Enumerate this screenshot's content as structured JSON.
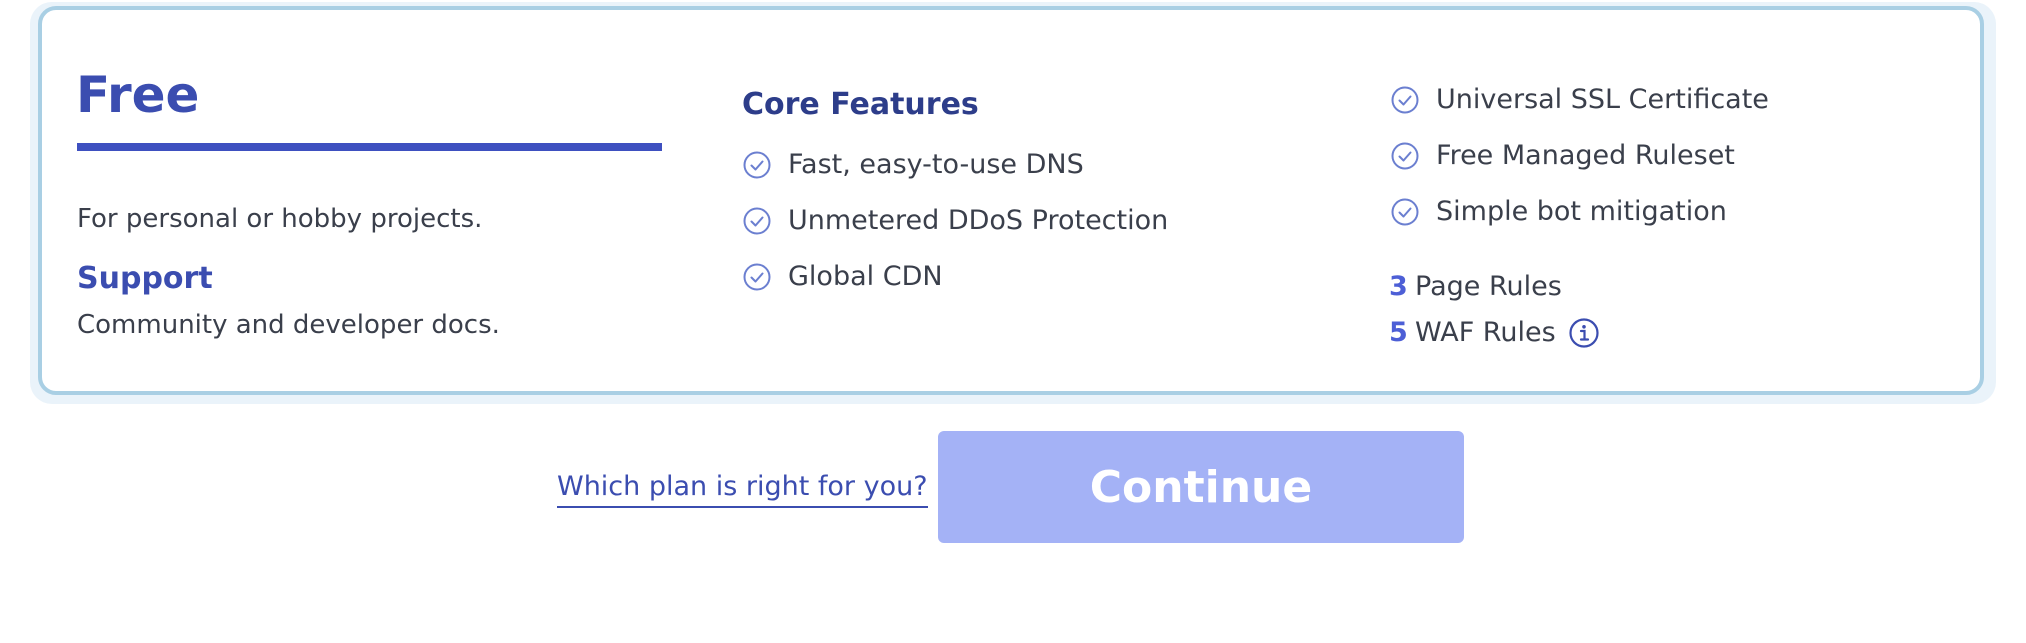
{
  "plan": {
    "name": "Free",
    "description": "For personal or hobby projects.",
    "support_heading": "Support",
    "support_text": "Community and developer docs."
  },
  "core_features": {
    "heading": "Core Features",
    "items": [
      {
        "label": "Fast, easy-to-use DNS",
        "icon": "check-circle-icon"
      },
      {
        "label": "Unmetered DDoS Protection",
        "icon": "check-circle-icon"
      },
      {
        "label": "Global CDN",
        "icon": "check-circle-icon"
      }
    ]
  },
  "extra_features": {
    "items": [
      {
        "label": "Universal SSL Certificate",
        "icon": "check-circle-icon"
      },
      {
        "label": "Free Managed Ruleset",
        "icon": "check-circle-icon"
      },
      {
        "label": "Simple bot mitigation",
        "icon": "check-circle-icon"
      }
    ],
    "rules": [
      {
        "count": "3",
        "label": "Page Rules"
      },
      {
        "count": "5",
        "label": "WAF Rules",
        "icon": "info-icon"
      }
    ]
  },
  "actions": {
    "help_link": "Which plan is right for you?",
    "continue_label": "Continue"
  },
  "colors": {
    "accent": "#3b4db0",
    "check": "#6b7fd0",
    "button_disabled": "#a4b2f6",
    "card_border": "#a9cfe4"
  }
}
